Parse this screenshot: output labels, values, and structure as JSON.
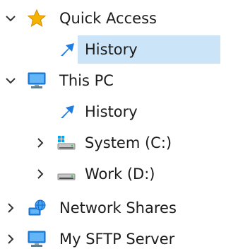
{
  "colors": {
    "selection": "#cce4f7",
    "text": "#1b1b1b",
    "chevron": "#333333",
    "star": "#f5b301",
    "monitor": "#1e88e5",
    "history_arrow": "#1f7de0",
    "windows_blue": "#00a4ef"
  },
  "tree": {
    "items": [
      {
        "label": "Quick Access",
        "icon": "star-icon",
        "chevron": "expanded"
      },
      {
        "label": "History",
        "icon": "history-icon",
        "selected": true
      },
      {
        "label": "This PC",
        "icon": "monitor-icon",
        "chevron": "expanded"
      },
      {
        "label": "History",
        "icon": "history-icon"
      },
      {
        "label": "System (C:)",
        "icon": "system-drive-icon",
        "chevron": "collapsed"
      },
      {
        "label": "Work (D:)",
        "icon": "drive-icon",
        "chevron": "collapsed"
      },
      {
        "label": "Network Shares",
        "icon": "network-icon",
        "chevron": "collapsed"
      },
      {
        "label": "My SFTP Server",
        "icon": "monitor-icon",
        "chevron": "collapsed"
      }
    ]
  }
}
